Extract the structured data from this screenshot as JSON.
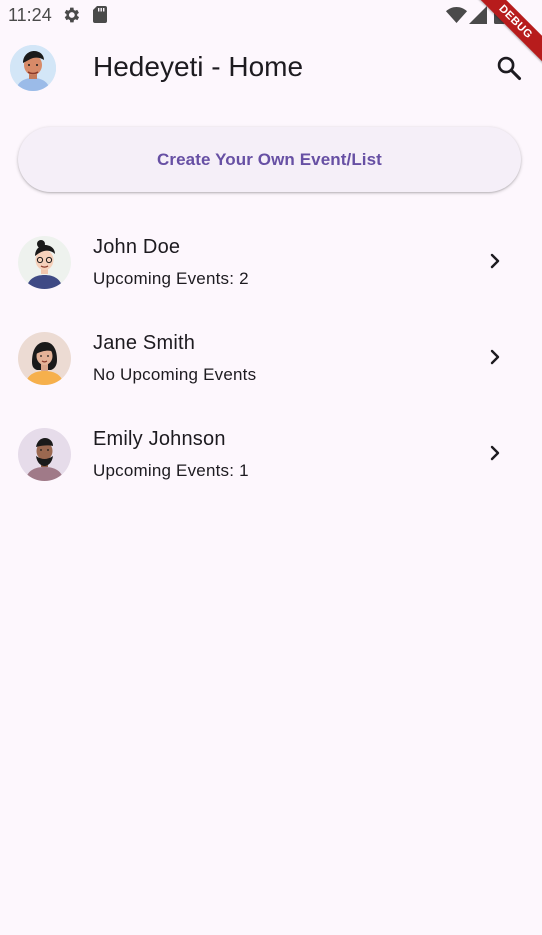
{
  "status_bar": {
    "time": "11:24",
    "icons": [
      "gear-icon",
      "sd-card-icon",
      "wifi-icon",
      "signal-icon",
      "battery-icon"
    ]
  },
  "debug_banner": "DEBUG",
  "app_bar": {
    "title": "Hedeyeti - Home",
    "avatar": "user-avatar",
    "search_icon": "search-icon"
  },
  "create_button": {
    "label": "Create Your Own Event/List"
  },
  "friends": [
    {
      "name": "John Doe",
      "subtitle": "Upcoming Events: 2",
      "avatar": "avatar-john"
    },
    {
      "name": "Jane Smith",
      "subtitle": "No Upcoming Events",
      "avatar": "avatar-jane"
    },
    {
      "name": "Emily Johnson",
      "subtitle": "Upcoming Events: 1",
      "avatar": "avatar-emily"
    }
  ],
  "colors": {
    "background": "#fdf7fd",
    "primary": "#6750a4",
    "button_bg": "#f5eff8",
    "debug": "#b71c1c"
  }
}
